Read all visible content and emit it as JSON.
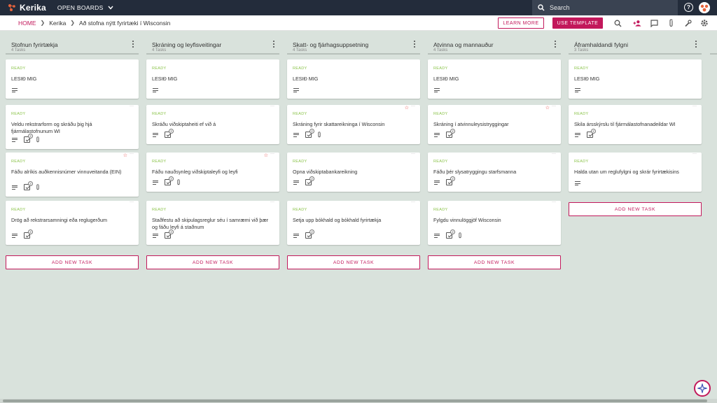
{
  "app": {
    "logo_text": "Kerika",
    "open_boards": "OPEN BOARDS"
  },
  "search": {
    "placeholder": "Search"
  },
  "breadcrumb": {
    "home": "HOME",
    "account": "Kerika",
    "board": "Að stofna nýtt fyrirtæki í Wisconsin"
  },
  "header": {
    "learn_more": "LEARN MORE",
    "use_template": "USE TEMPLATE"
  },
  "icons": {
    "search": "search-icon",
    "add_person": "add-person-icon",
    "chat": "chat-icon",
    "attach": "paperclip-icon",
    "tools": "tools-icon",
    "settings": "gear-icon",
    "help": "help-icon"
  },
  "colors": {
    "accent": "#c2185b",
    "ready": "#8bc34a",
    "star": "#e53935",
    "topbar": "#232c3b",
    "board_bg": "#d9e2dc"
  },
  "add_task_label": "ADD NEW TASK",
  "columns": [
    {
      "title": "Stofnun fyrirtækja",
      "count": "4 Tasks",
      "cards": [
        {
          "status": "READY",
          "title": "LESIÐ MIG"
        },
        {
          "status": "READY",
          "title": "Veldu rekstrarform og skráðu þig hjá fjármálastofnunum WI",
          "badge": "2"
        },
        {
          "status": "READY",
          "title": "Fáðu alríkis auðkennisnúmer vinnuveitanda (EIN)",
          "badge": "2"
        },
        {
          "status": "READY",
          "title": "Drög að rekstrarsamningi eða reglugerðum",
          "badge": "2"
        }
      ]
    },
    {
      "title": "Skráning og leyfisveitingar",
      "count": "4 Tasks",
      "cards": [
        {
          "status": "READY",
          "title": "LESIÐ MIG"
        },
        {
          "status": "READY",
          "title": "Skráðu viðskiptaheiti ef við á",
          "badge": "2"
        },
        {
          "status": "READY",
          "title": "Fáðu nauðsynleg viðskiptaleyfi og leyfi",
          "badge": "2"
        },
        {
          "status": "READY",
          "title": "Staðfestu að skipulagsreglur séu í samræmi við þær og fáðu leyfi á staðnum",
          "badge": "2"
        }
      ]
    },
    {
      "title": "Skatt- og fjárhagsuppsetning",
      "count": "4 Tasks",
      "cards": [
        {
          "status": "READY",
          "title": "LESIÐ MIG"
        },
        {
          "status": "READY",
          "title": "Skráning fyrir skattareikninga í Wisconsin",
          "badge": "2"
        },
        {
          "status": "READY",
          "title": "Opna viðskiptabankareikning",
          "badge": "2"
        },
        {
          "status": "READY",
          "title": "Setja upp bókhald og bókhald fyrirtækja",
          "badge": "2"
        }
      ]
    },
    {
      "title": "Atvinna og mannauður",
      "count": "4 Tasks",
      "cards": [
        {
          "status": "READY",
          "title": "LESIÐ MIG"
        },
        {
          "status": "READY",
          "title": "Skráning í atvinnuleysistryggingar",
          "badge": "2"
        },
        {
          "status": "READY",
          "title": "Fáðu þér slysatryggingu starfsmanna",
          "badge": "2"
        },
        {
          "status": "READY",
          "title": "Fylgdu vinnulöggjöf Wisconsin",
          "badge": "2"
        }
      ]
    },
    {
      "title": "Áframhaldandi fylgni",
      "count": "3 Tasks",
      "cards": [
        {
          "status": "READY",
          "title": "LESIÐ MIG"
        },
        {
          "status": "READY",
          "title": "Skila ársskýrslu til fjármálastofnanadeildar WI",
          "badge": "2"
        },
        {
          "status": "READY",
          "title": "Halda utan um reglufylgni og skrár fyrirtækisins"
        }
      ]
    }
  ]
}
